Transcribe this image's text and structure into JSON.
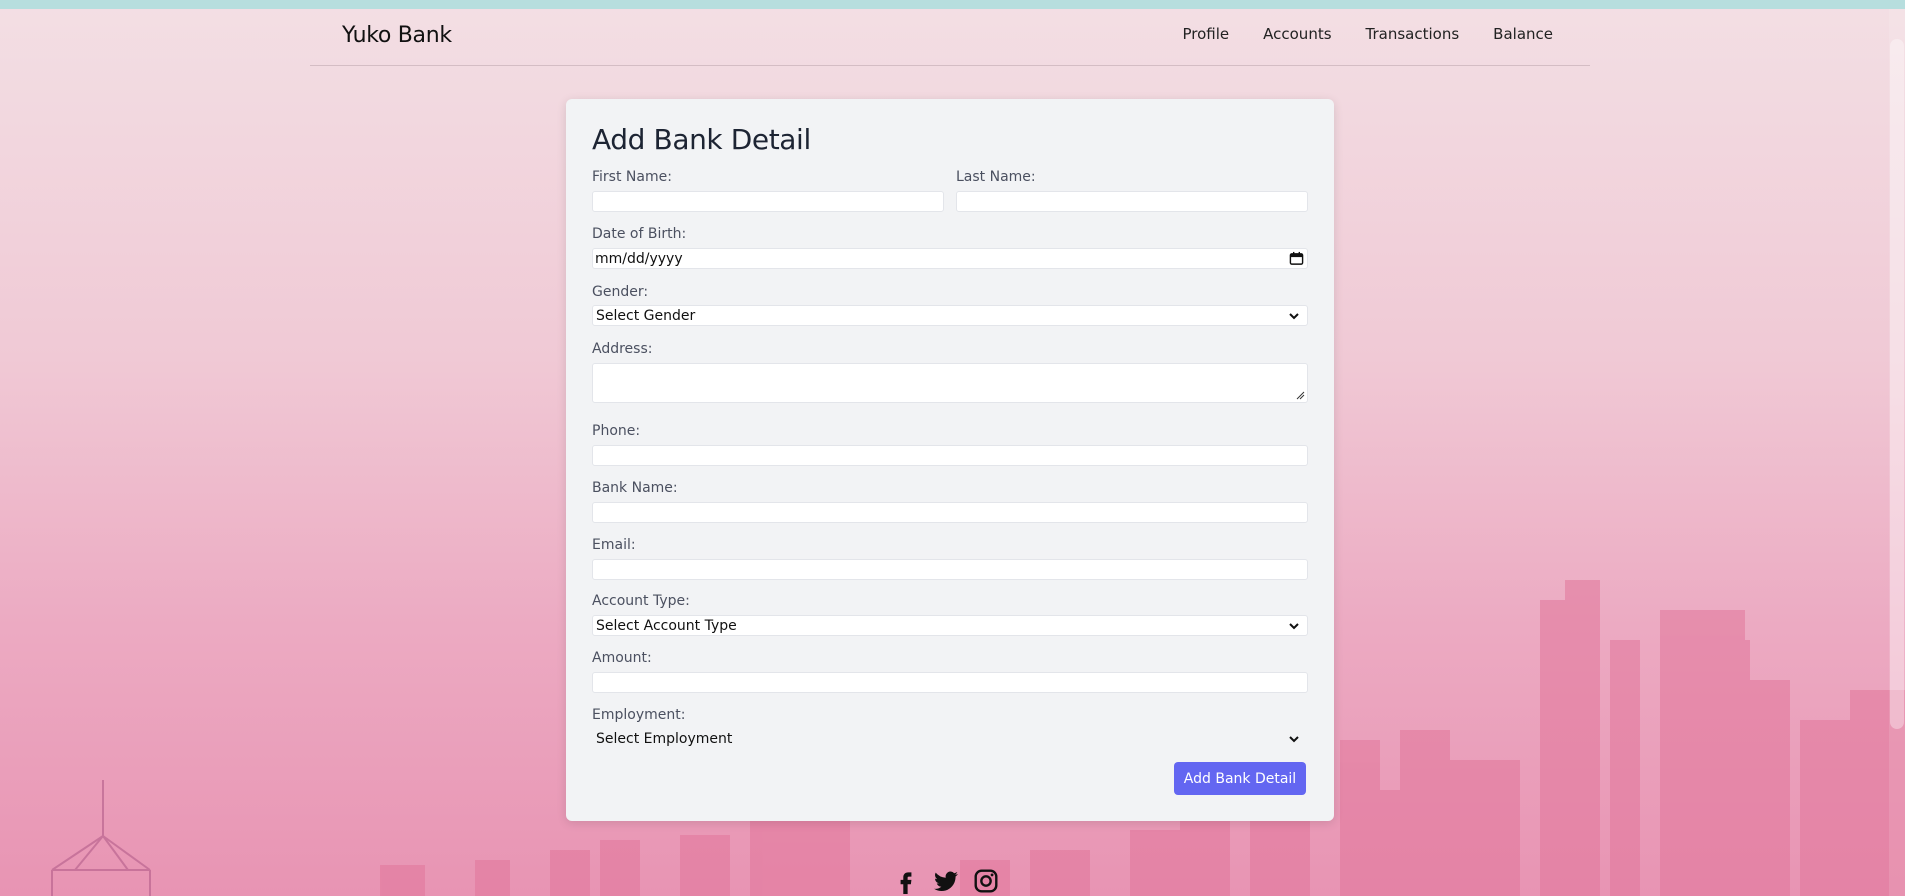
{
  "brand": "Yuko Bank",
  "nav": {
    "items": [
      "Profile",
      "Accounts",
      "Transactions",
      "Balance"
    ]
  },
  "form": {
    "title": "Add Bank Detail",
    "first_name_label": "First Name:",
    "last_name_label": "Last Name:",
    "dob_label": "Date of Birth:",
    "dob_value": "mm/dd/yyyy",
    "gender_label": "Gender:",
    "gender_value": "Select Gender",
    "address_label": "Address:",
    "phone_label": "Phone:",
    "bank_name_label": "Bank Name:",
    "email_label": "Email:",
    "account_type_label": "Account Type:",
    "account_type_value": "Select Account Type",
    "amount_label": "Amount:",
    "employment_label": "Employment:",
    "employment_value": "Select Employment",
    "submit_label": "Add Bank Detail"
  },
  "social": {
    "icons": [
      "facebook-icon",
      "twitter-icon",
      "instagram-icon"
    ]
  },
  "colors": {
    "accent": "#6366f1",
    "card_bg": "#f2f3f5",
    "top_strip": "#b7dede"
  }
}
